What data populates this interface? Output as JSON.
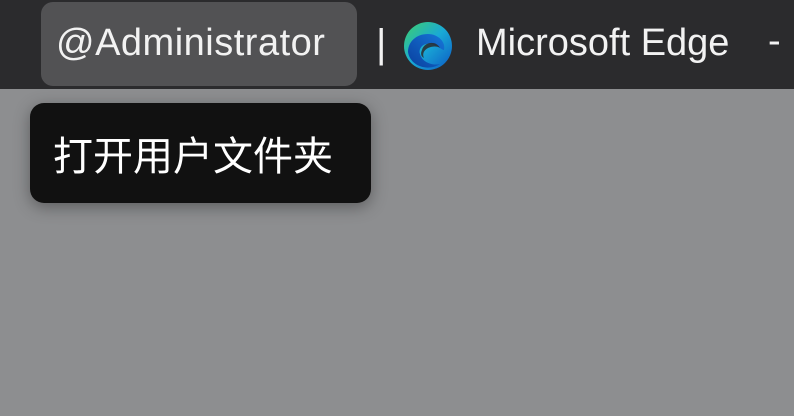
{
  "titlebar": {
    "user_label": "@Administrator",
    "separator": "|",
    "app_name": "Microsoft Edge",
    "trailing_dash": "-",
    "app_icon": "microsoft-edge-icon"
  },
  "tooltip": {
    "label": "打开用户文件夹"
  },
  "colors": {
    "titlebar_bg": "#2b2b2d",
    "pill_bg": "#525254",
    "page_bg": "#8d8e90",
    "tooltip_bg": "#111111",
    "text": "#f2f2f2"
  }
}
